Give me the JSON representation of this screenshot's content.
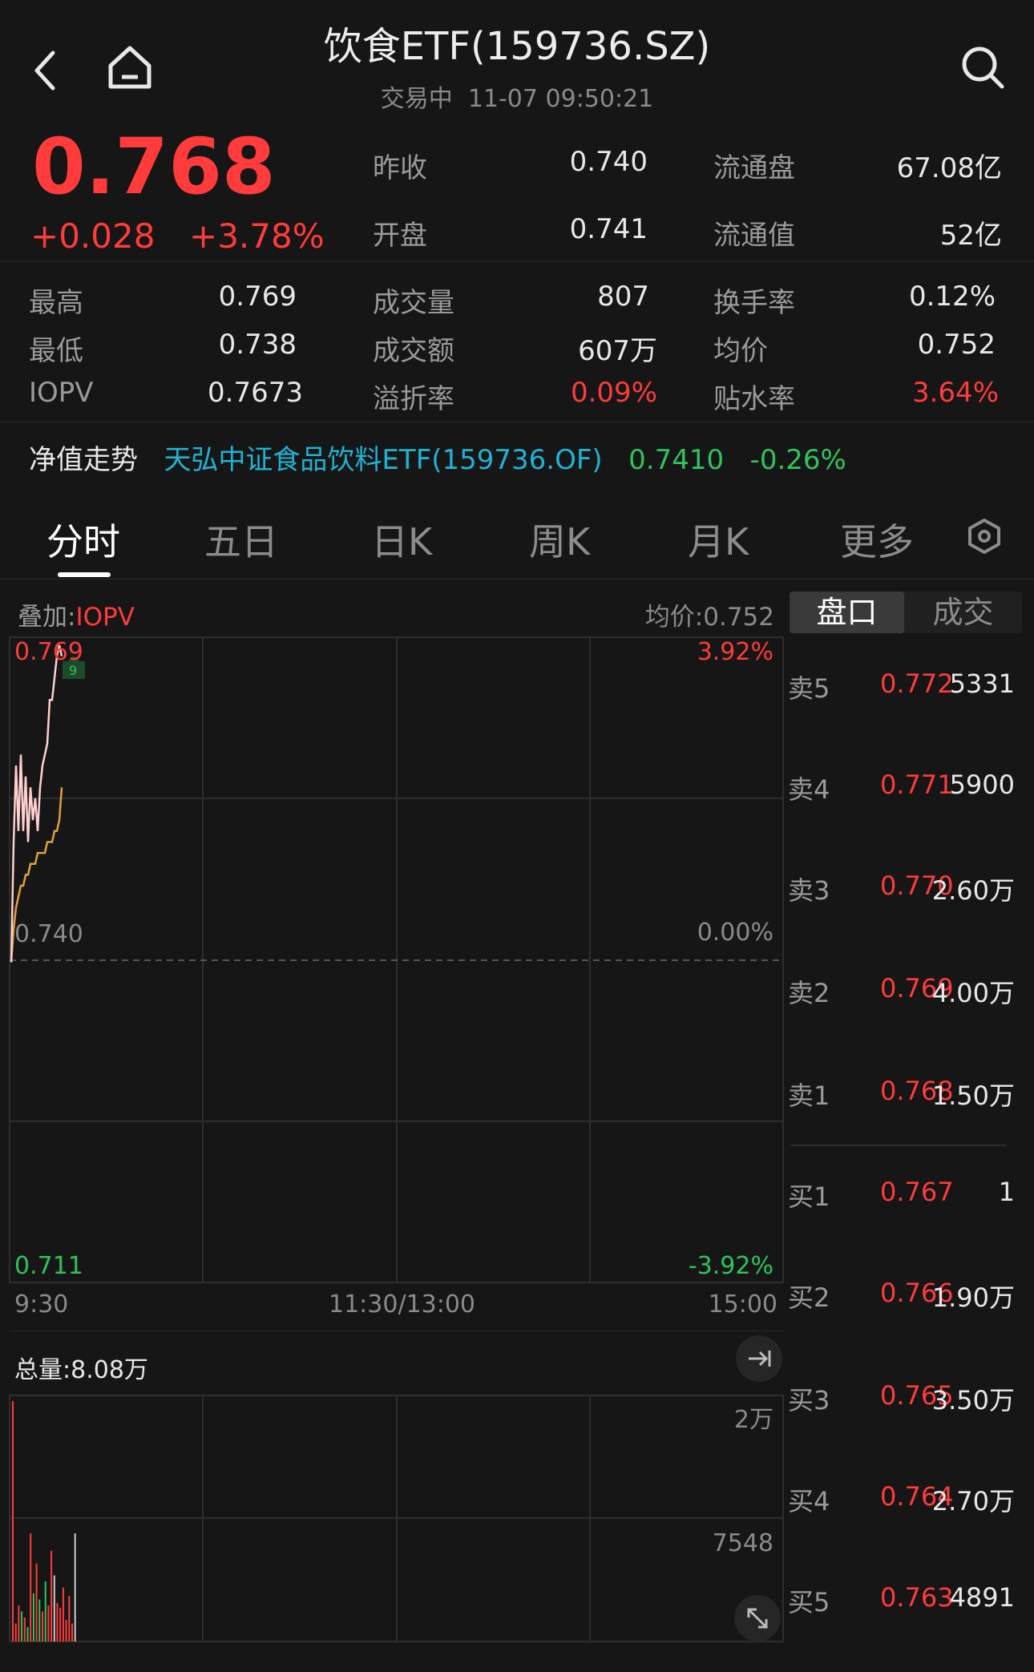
{
  "header": {
    "title": "饮食ETF(159736.SZ)",
    "status": "交易中",
    "datetime": "11-07 09:50:21"
  },
  "quote": {
    "price": "0.768",
    "change": "+0.028",
    "change_pct": "+3.78%"
  },
  "stats_top": [
    {
      "label": "昨收",
      "value": "0.740"
    },
    {
      "label": "开盘",
      "value": "0.741"
    },
    {
      "label": "流通盘",
      "value": "67.08亿"
    },
    {
      "label": "流通值",
      "value": "52亿"
    }
  ],
  "stats": [
    {
      "label": "最高",
      "value": "0.769"
    },
    {
      "label": "最低",
      "value": "0.738"
    },
    {
      "label": "IOPV",
      "value": "0.7673"
    },
    {
      "label": "成交量",
      "value": "807"
    },
    {
      "label": "成交额",
      "value": "607万"
    },
    {
      "label": "溢折率",
      "value": "0.09%"
    },
    {
      "label": "换手率",
      "value": "0.12%"
    },
    {
      "label": "均价",
      "value": "0.752"
    },
    {
      "label": "贴水率",
      "value": "3.64%"
    }
  ],
  "nav": {
    "label": "净值走势",
    "fund": "天弘中证食品饮料ETF(159736.OF)",
    "value": "0.7410",
    "change": "-0.26%"
  },
  "tabs": [
    "分时",
    "五日",
    "日K",
    "周K",
    "月K",
    "更多"
  ],
  "chart": {
    "overlay_label": "叠加:",
    "overlay_value": "IOPV",
    "avg_label": "均价:0.752",
    "y_top": "0.769",
    "y_mid": "0.740",
    "y_bottom": "0.711",
    "pct_top": "3.92%",
    "pct_mid": "0.00%",
    "pct_bottom": "-3.92%",
    "x_start": "9:30",
    "x_mid": "11:30/13:00",
    "x_end": "15:00",
    "high_marker": "9",
    "volume_label": "总量:8.08万",
    "vol_top": "2万",
    "vol_mid": "7548"
  },
  "orderbook_tabs": [
    "盘口",
    "成交"
  ],
  "orderbook": [
    {
      "label": "卖5",
      "price": "0.772",
      "vol": "5331"
    },
    {
      "label": "卖4",
      "price": "0.771",
      "vol": "5900"
    },
    {
      "label": "卖3",
      "price": "0.770",
      "vol": "2.60万"
    },
    {
      "label": "卖2",
      "price": "0.769",
      "vol": "4.00万"
    },
    {
      "label": "卖1",
      "price": "0.768",
      "vol": "1.50万"
    },
    {
      "label": "买1",
      "price": "0.767",
      "vol": "1"
    },
    {
      "label": "买2",
      "price": "0.766",
      "vol": "1.90万"
    },
    {
      "label": "买3",
      "price": "0.765",
      "vol": "3.50万"
    },
    {
      "label": "买4",
      "price": "0.764",
      "vol": "2.70万"
    },
    {
      "label": "买5",
      "price": "0.763",
      "vol": "4891"
    }
  ],
  "chart_data": {
    "type": "line",
    "y_range": [
      0.711,
      0.769
    ],
    "prev_close": 0.74,
    "x_session": [
      "9:30",
      "15:00"
    ],
    "series": [
      {
        "name": "price",
        "color": "#ffd0d0",
        "values": [
          0.74,
          0.751,
          0.758,
          0.752,
          0.759,
          0.752,
          0.757,
          0.751,
          0.756,
          0.753,
          0.755,
          0.752,
          0.756,
          0.758,
          0.759,
          0.76,
          0.764,
          0.764,
          0.766,
          0.768,
          0.769,
          0.768
        ]
      },
      {
        "name": "avg",
        "color": "#e0a040",
        "values": [
          0.74,
          0.743,
          0.745,
          0.746,
          0.747,
          0.747,
          0.748,
          0.748,
          0.749,
          0.749,
          0.749,
          0.75,
          0.75,
          0.75,
          0.75,
          0.751,
          0.751,
          0.751,
          0.752,
          0.752,
          0.753,
          0.756
        ]
      }
    ],
    "volume": [
      {
        "v": 20000,
        "c": "r"
      },
      {
        "v": 1500,
        "c": "r"
      },
      {
        "v": 3000,
        "c": "r"
      },
      {
        "v": 2500,
        "c": "g"
      },
      {
        "v": 2000,
        "c": "r"
      },
      {
        "v": 1200,
        "c": "g"
      },
      {
        "v": 9000,
        "c": "r"
      },
      {
        "v": 4000,
        "c": "g"
      },
      {
        "v": 6500,
        "c": "r"
      },
      {
        "v": 3500,
        "c": "g"
      },
      {
        "v": 2500,
        "c": "r"
      },
      {
        "v": 5000,
        "c": "g"
      },
      {
        "v": 3000,
        "c": "r"
      },
      {
        "v": 7548,
        "c": "r"
      },
      {
        "v": 5500,
        "c": "w"
      },
      {
        "v": 3200,
        "c": "r"
      },
      {
        "v": 2800,
        "c": "r"
      },
      {
        "v": 4500,
        "c": "r"
      },
      {
        "v": 1800,
        "c": "r"
      },
      {
        "v": 3800,
        "c": "r"
      },
      {
        "v": 1500,
        "c": "r"
      },
      {
        "v": 9000,
        "c": "w"
      }
    ]
  }
}
